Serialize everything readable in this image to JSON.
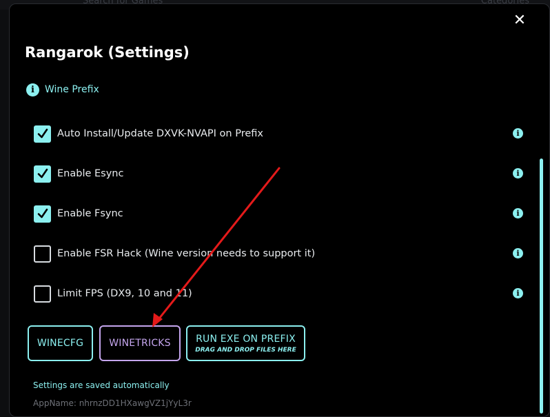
{
  "background": {
    "search_hint": "Search for Games",
    "categories_hint": "Categories"
  },
  "dialog": {
    "title": "Rangarok (Settings)",
    "close_glyph": "✕",
    "section_label": "Wine Prefix"
  },
  "settings": [
    {
      "label": "Auto Install/Update DXVK-NVAPI on Prefix",
      "checked": true
    },
    {
      "label": "Enable Esync",
      "checked": true
    },
    {
      "label": "Enable Fsync",
      "checked": true
    },
    {
      "label": "Enable FSR Hack (Wine version needs to support it)",
      "checked": false
    },
    {
      "label": "Limit FPS (DX9, 10 and 11)",
      "checked": false
    }
  ],
  "buttons": {
    "winecfg": "WINECFG",
    "winetricks": "WINETRICKS",
    "run_exe": "RUN EXE ON PREFIX",
    "run_exe_hint": "DRAG AND DROP FILES HERE"
  },
  "footer": {
    "saved_note": "Settings are saved automatically",
    "appname": "AppName:  nhrnzDD1HXawgVZ1jYyL3r"
  },
  "colors": {
    "accent": "#8cf0f0",
    "purple": "#c5a6ee",
    "arrow": "#e41a1a"
  },
  "icons": {
    "info": "info-icon",
    "check": "check-icon",
    "close": "close-icon"
  }
}
